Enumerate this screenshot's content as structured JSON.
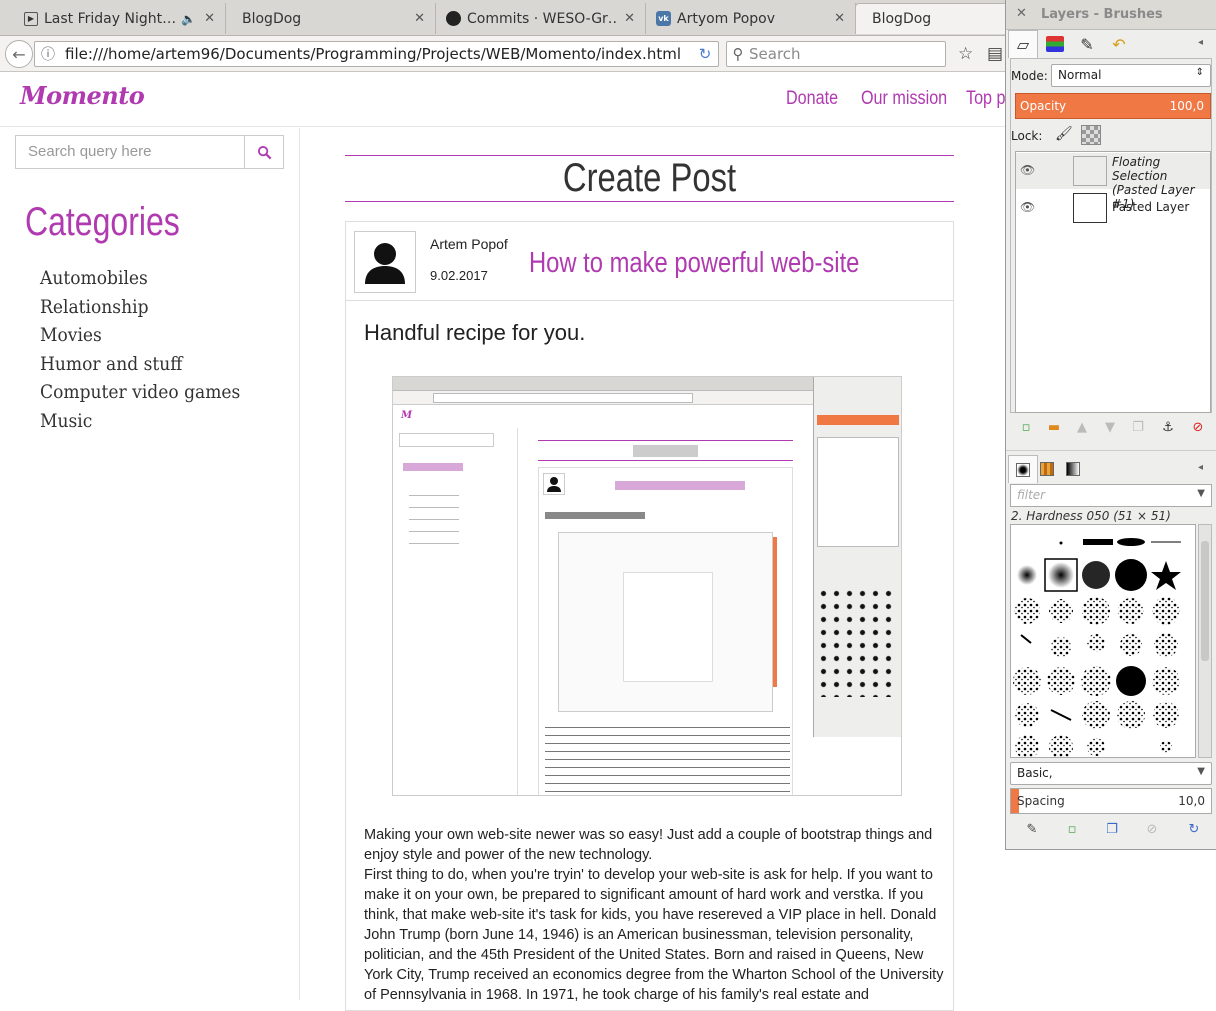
{
  "browser": {
    "tabs": [
      {
        "title": "Last Friday Night…",
        "icon": "play-icon"
      },
      {
        "title": "BlogDog",
        "icon": ""
      },
      {
        "title": "Commits · WESO-Gr…",
        "icon": "github-icon"
      },
      {
        "title": "Artyom Popov",
        "icon": "vk-icon"
      },
      {
        "title": "BlogDog",
        "icon": ""
      }
    ],
    "url": "file:///home/artem96/Documents/Programming/Projects/WEB/Momento/index.html",
    "search_placeholder": "Search"
  },
  "site": {
    "logo": "Momento",
    "nav": [
      "Donate",
      "Our mission",
      "Top p"
    ],
    "search_placeholder": "Search query here",
    "categories_title": "Categories",
    "categories": [
      "Automobiles",
      "Relationship",
      "Movies",
      "Humor and stuff",
      "Computer video games",
      "Music"
    ],
    "page_title": "Create Post",
    "post": {
      "author": "Artem Popof",
      "date": "9.02.2017",
      "title": "How to make powerful web-site",
      "subtitle": "Handful recipe for you.",
      "body": [
        "Making your own web-site newer was so easy! Just add a couple of bootstrap things and enjoy style and power of the new technology.",
        "First thing to do, when you're tryin' to develop your web-site is ask for help. If you want to make it on your own, be prepared to significant amount of hard work and verstka. If you think, that make web-site it's task for kids, you have resereved a VIP place in hell. Donald John Trump (born June 14, 1946) is an American businessman, television personality, politician, and the 45th President of the United States. Born and raised in Queens, New York City, Trump received an economics degree from the Wharton School of the University of Pennsylvania in 1968. In 1971, he took charge of his family's real estate and"
      ]
    }
  },
  "gimp": {
    "title": "Layers - Brushes",
    "mode_label": "Mode:",
    "mode_value": "Normal",
    "opacity_label": "Opacity",
    "opacity_value": "100,0",
    "lock_label": "Lock:",
    "layers": [
      {
        "name": "Floating Selection (Pasted Layer #1)",
        "selected": true
      },
      {
        "name": "Pasted Layer",
        "selected": false
      }
    ],
    "filter_placeholder": "filter",
    "brush_name": "2. Hardness 050 (51 × 51)",
    "brush_preset": "Basic,",
    "spacing_label": "Spacing",
    "spacing_value": "10,0"
  },
  "colors": {
    "accent": "#b03ab0",
    "gimp_orange": "#f07845"
  }
}
